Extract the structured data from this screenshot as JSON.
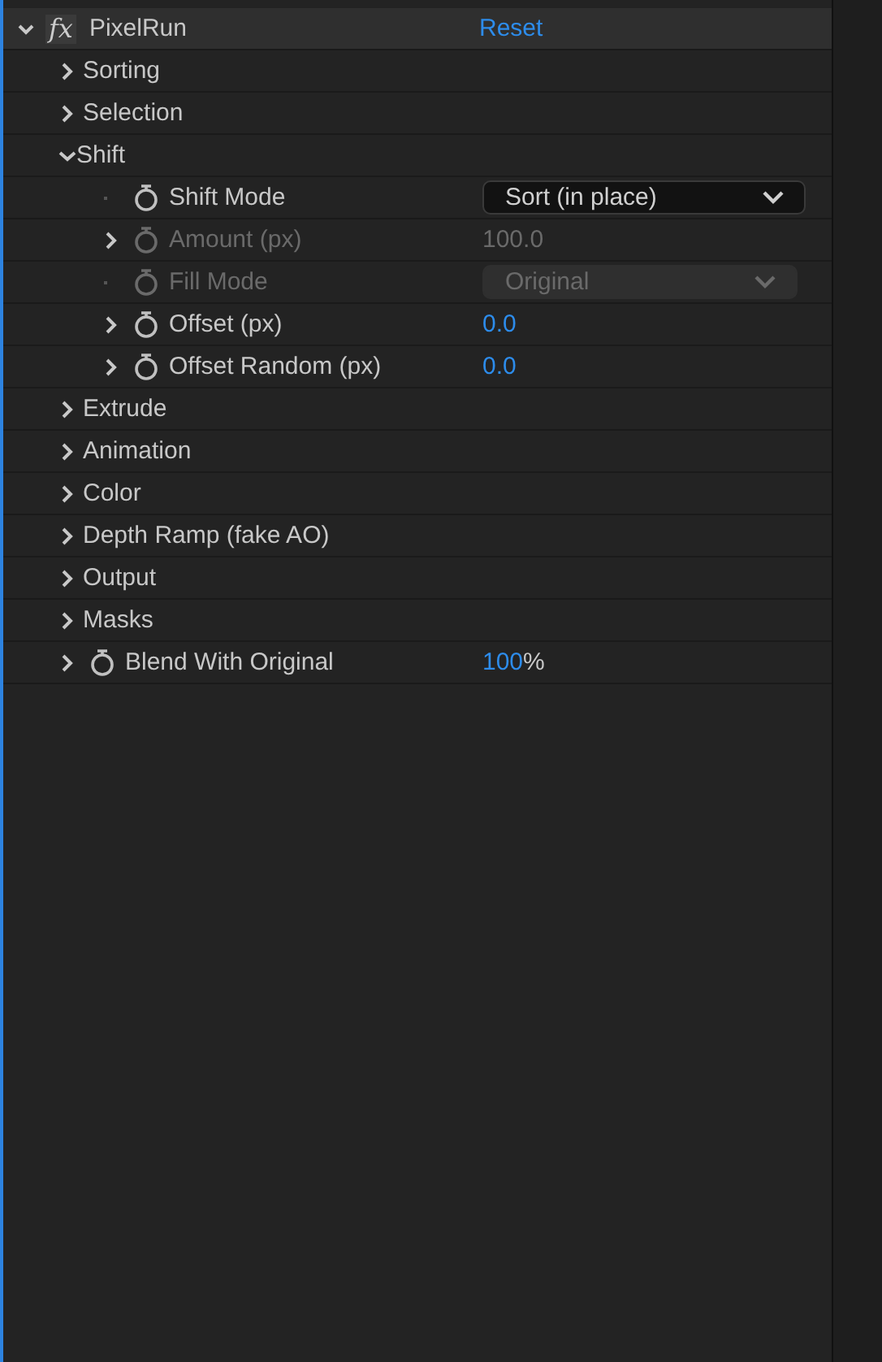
{
  "effect": {
    "badge": "fx",
    "name": "PixelRun",
    "expanded": true,
    "reset": "Reset"
  },
  "items": [
    {
      "kind": "group",
      "label": "Sorting",
      "expanded": false
    },
    {
      "kind": "group",
      "label": "Selection",
      "expanded": false
    },
    {
      "kind": "group",
      "label": "Shift",
      "expanded": true,
      "children": [
        {
          "kind": "dropdown",
          "label": "Shift Mode",
          "value": "Sort (in place)",
          "disabled": false
        },
        {
          "kind": "number",
          "label": "Amount (px)",
          "value": "100.0",
          "disabled": true
        },
        {
          "kind": "dropdown",
          "label": "Fill Mode",
          "value": "Original",
          "disabled": true
        },
        {
          "kind": "number",
          "label": "Offset (px)",
          "value": "0.0",
          "disabled": false
        },
        {
          "kind": "number",
          "label": "Offset Random (px)",
          "value": "0.0",
          "disabled": false
        }
      ]
    },
    {
      "kind": "group",
      "label": "Extrude",
      "expanded": false
    },
    {
      "kind": "group",
      "label": "Animation",
      "expanded": false
    },
    {
      "kind": "group",
      "label": "Color",
      "expanded": false
    },
    {
      "kind": "group",
      "label": "Depth Ramp (fake AO)",
      "expanded": false
    },
    {
      "kind": "group",
      "label": "Output",
      "expanded": false
    },
    {
      "kind": "group",
      "label": "Masks",
      "expanded": false
    },
    {
      "kind": "number",
      "label": "Blend With Original",
      "value": "100",
      "unit": "%",
      "disabled": false
    }
  ]
}
